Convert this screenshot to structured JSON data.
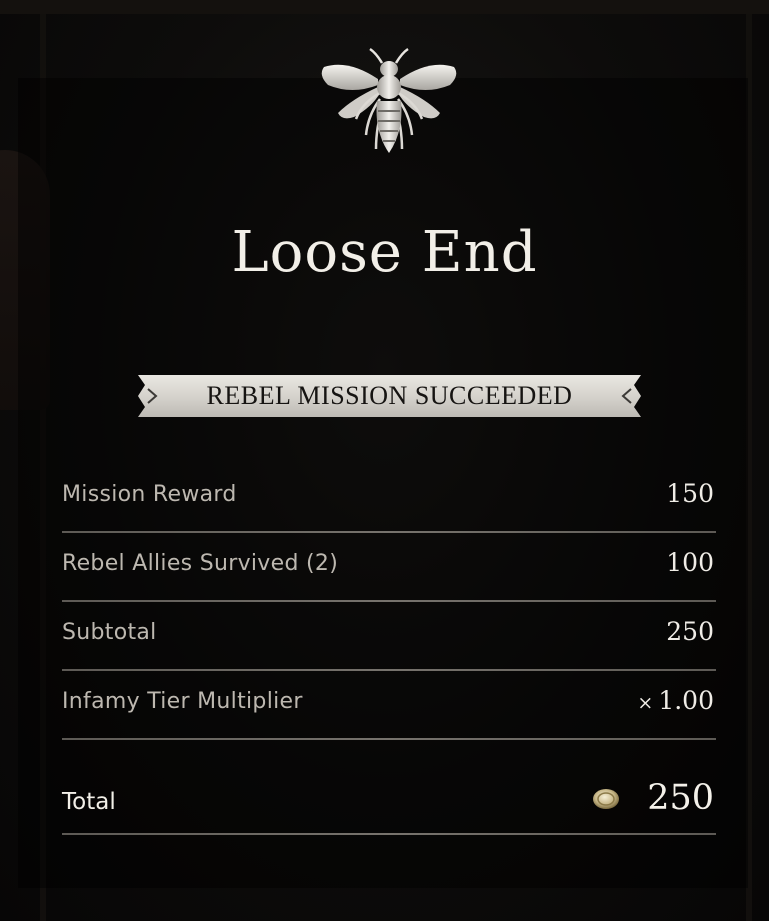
{
  "mission": {
    "title": "Loose End",
    "status_banner": "REBEL MISSION SUCCEEDED",
    "emblem_icon": "bee-icon"
  },
  "rewards": [
    {
      "label": "Mission Reward",
      "value": "150"
    },
    {
      "label": "Rebel Allies Survived (2)",
      "value": "100"
    },
    {
      "label": "Subtotal",
      "value": "250"
    }
  ],
  "multiplier": {
    "label": "Infamy Tier Multiplier",
    "sign": "×",
    "value": "1.00"
  },
  "total": {
    "label": "Total",
    "value": "250",
    "currency_icon": "coin-icon"
  },
  "colors": {
    "banner": "#d9d6d0",
    "text_primary": "#f2efe8",
    "text_secondary": "#bdb8b0",
    "background": "#0b0a09"
  }
}
